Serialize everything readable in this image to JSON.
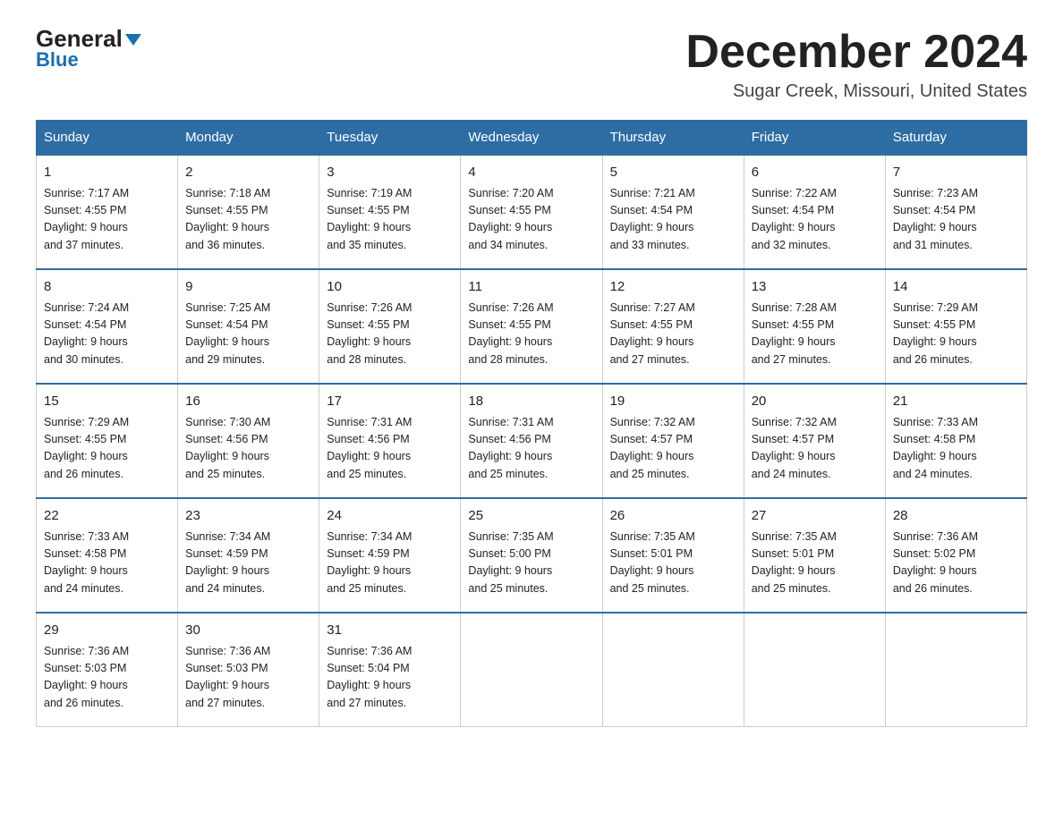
{
  "header": {
    "logo_general": "General",
    "logo_blue": "Blue",
    "month_title": "December 2024",
    "location": "Sugar Creek, Missouri, United States"
  },
  "days_of_week": [
    "Sunday",
    "Monday",
    "Tuesday",
    "Wednesday",
    "Thursday",
    "Friday",
    "Saturday"
  ],
  "weeks": [
    [
      {
        "day": "1",
        "sunrise": "7:17 AM",
        "sunset": "4:55 PM",
        "daylight": "9 hours and 37 minutes."
      },
      {
        "day": "2",
        "sunrise": "7:18 AM",
        "sunset": "4:55 PM",
        "daylight": "9 hours and 36 minutes."
      },
      {
        "day": "3",
        "sunrise": "7:19 AM",
        "sunset": "4:55 PM",
        "daylight": "9 hours and 35 minutes."
      },
      {
        "day": "4",
        "sunrise": "7:20 AM",
        "sunset": "4:55 PM",
        "daylight": "9 hours and 34 minutes."
      },
      {
        "day": "5",
        "sunrise": "7:21 AM",
        "sunset": "4:54 PM",
        "daylight": "9 hours and 33 minutes."
      },
      {
        "day": "6",
        "sunrise": "7:22 AM",
        "sunset": "4:54 PM",
        "daylight": "9 hours and 32 minutes."
      },
      {
        "day": "7",
        "sunrise": "7:23 AM",
        "sunset": "4:54 PM",
        "daylight": "9 hours and 31 minutes."
      }
    ],
    [
      {
        "day": "8",
        "sunrise": "7:24 AM",
        "sunset": "4:54 PM",
        "daylight": "9 hours and 30 minutes."
      },
      {
        "day": "9",
        "sunrise": "7:25 AM",
        "sunset": "4:54 PM",
        "daylight": "9 hours and 29 minutes."
      },
      {
        "day": "10",
        "sunrise": "7:26 AM",
        "sunset": "4:55 PM",
        "daylight": "9 hours and 28 minutes."
      },
      {
        "day": "11",
        "sunrise": "7:26 AM",
        "sunset": "4:55 PM",
        "daylight": "9 hours and 28 minutes."
      },
      {
        "day": "12",
        "sunrise": "7:27 AM",
        "sunset": "4:55 PM",
        "daylight": "9 hours and 27 minutes."
      },
      {
        "day": "13",
        "sunrise": "7:28 AM",
        "sunset": "4:55 PM",
        "daylight": "9 hours and 27 minutes."
      },
      {
        "day": "14",
        "sunrise": "7:29 AM",
        "sunset": "4:55 PM",
        "daylight": "9 hours and 26 minutes."
      }
    ],
    [
      {
        "day": "15",
        "sunrise": "7:29 AM",
        "sunset": "4:55 PM",
        "daylight": "9 hours and 26 minutes."
      },
      {
        "day": "16",
        "sunrise": "7:30 AM",
        "sunset": "4:56 PM",
        "daylight": "9 hours and 25 minutes."
      },
      {
        "day": "17",
        "sunrise": "7:31 AM",
        "sunset": "4:56 PM",
        "daylight": "9 hours and 25 minutes."
      },
      {
        "day": "18",
        "sunrise": "7:31 AM",
        "sunset": "4:56 PM",
        "daylight": "9 hours and 25 minutes."
      },
      {
        "day": "19",
        "sunrise": "7:32 AM",
        "sunset": "4:57 PM",
        "daylight": "9 hours and 25 minutes."
      },
      {
        "day": "20",
        "sunrise": "7:32 AM",
        "sunset": "4:57 PM",
        "daylight": "9 hours and 24 minutes."
      },
      {
        "day": "21",
        "sunrise": "7:33 AM",
        "sunset": "4:58 PM",
        "daylight": "9 hours and 24 minutes."
      }
    ],
    [
      {
        "day": "22",
        "sunrise": "7:33 AM",
        "sunset": "4:58 PM",
        "daylight": "9 hours and 24 minutes."
      },
      {
        "day": "23",
        "sunrise": "7:34 AM",
        "sunset": "4:59 PM",
        "daylight": "9 hours and 24 minutes."
      },
      {
        "day": "24",
        "sunrise": "7:34 AM",
        "sunset": "4:59 PM",
        "daylight": "9 hours and 25 minutes."
      },
      {
        "day": "25",
        "sunrise": "7:35 AM",
        "sunset": "5:00 PM",
        "daylight": "9 hours and 25 minutes."
      },
      {
        "day": "26",
        "sunrise": "7:35 AM",
        "sunset": "5:01 PM",
        "daylight": "9 hours and 25 minutes."
      },
      {
        "day": "27",
        "sunrise": "7:35 AM",
        "sunset": "5:01 PM",
        "daylight": "9 hours and 25 minutes."
      },
      {
        "day": "28",
        "sunrise": "7:36 AM",
        "sunset": "5:02 PM",
        "daylight": "9 hours and 26 minutes."
      }
    ],
    [
      {
        "day": "29",
        "sunrise": "7:36 AM",
        "sunset": "5:03 PM",
        "daylight": "9 hours and 26 minutes."
      },
      {
        "day": "30",
        "sunrise": "7:36 AM",
        "sunset": "5:03 PM",
        "daylight": "9 hours and 27 minutes."
      },
      {
        "day": "31",
        "sunrise": "7:36 AM",
        "sunset": "5:04 PM",
        "daylight": "9 hours and 27 minutes."
      },
      null,
      null,
      null,
      null
    ]
  ],
  "labels": {
    "sunrise_prefix": "Sunrise: ",
    "sunset_prefix": "Sunset: ",
    "daylight_prefix": "Daylight: "
  }
}
